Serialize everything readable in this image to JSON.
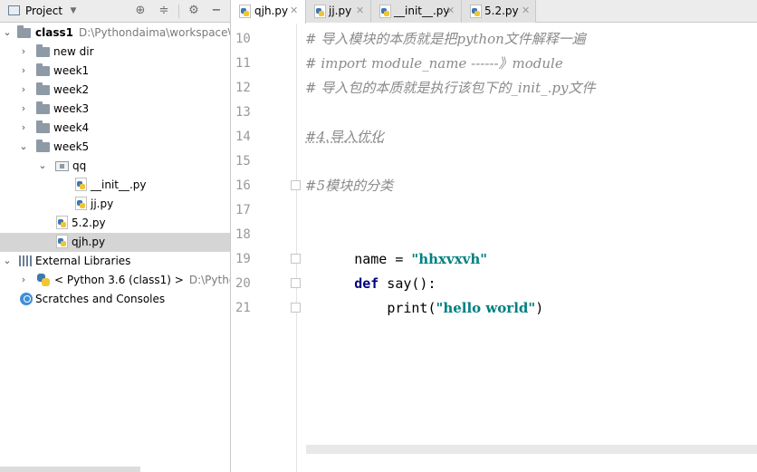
{
  "project_panel": {
    "title": "Project",
    "toolbar_icons": [
      "target-icon",
      "collapse-icon",
      "gear-icon",
      "minimize-icon"
    ],
    "tree": [
      {
        "name": "class1",
        "path": "D:\\Pythondaima\\workspace\\cl",
        "type": "root",
        "expanded": true
      },
      {
        "name": "new dir",
        "type": "folder",
        "expanded": false
      },
      {
        "name": "week1",
        "type": "folder",
        "expanded": false
      },
      {
        "name": "week2",
        "type": "folder",
        "expanded": false
      },
      {
        "name": "week3",
        "type": "folder",
        "expanded": false
      },
      {
        "name": "week4",
        "type": "folder",
        "expanded": false
      },
      {
        "name": "week5",
        "type": "folder",
        "expanded": true
      },
      {
        "name": "qq",
        "type": "package",
        "expanded": true
      },
      {
        "name": "__init__.py",
        "type": "python-file"
      },
      {
        "name": "jj.py",
        "type": "python-file"
      },
      {
        "name": "5.2.py",
        "type": "python-file"
      },
      {
        "name": "qjh.py",
        "type": "python-file",
        "selected": true
      },
      {
        "name": "External Libraries",
        "type": "libraries",
        "expanded": true
      },
      {
        "name": "< Python 3.6 (class1) >",
        "path": "D:\\Python",
        "type": "sdk",
        "expanded": false
      },
      {
        "name": "Scratches and Consoles",
        "type": "scratches"
      }
    ]
  },
  "tabs": [
    {
      "label": "qjh.py",
      "active": true
    },
    {
      "label": "jj.py",
      "active": false
    },
    {
      "label": "__init__.py",
      "active": false
    },
    {
      "label": "5.2.py",
      "active": false
    }
  ],
  "editor": {
    "line_numbers": [
      "10",
      "11",
      "12",
      "13",
      "14",
      "15",
      "16",
      "17",
      "18",
      "19",
      "20",
      "21"
    ],
    "lines": {
      "l10": "# 导入模块的本质就是把python文件解释一遍",
      "l11": "# import module_name ------》module",
      "l12": "# 导入包的本质就是执行该包下的_init_.py文件",
      "l14": "#4.导入优化",
      "l16": "#5模块的分类",
      "l18_var": "name",
      "l18_op": " = ",
      "l18_str": "\"hhxvxvh\"",
      "l19_kw": "def",
      "l19_fn": " say",
      "l19_rest": "():",
      "l20_indent": "    ",
      "l20_fn": "print",
      "l20_open": "(",
      "l20_str": "\"hello world\"",
      "l20_close": ")"
    }
  }
}
